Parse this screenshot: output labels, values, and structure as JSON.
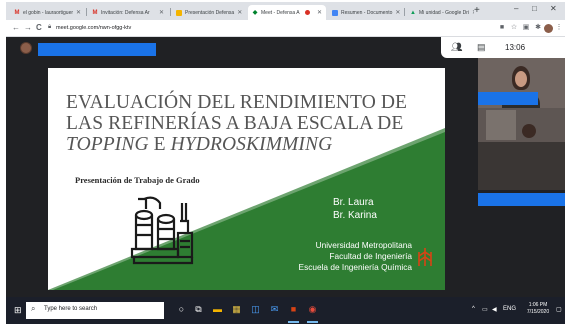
{
  "browser": {
    "tabs": [
      {
        "label": "el gobin - lauraortiguer",
        "icon": "gmail-icon",
        "icon_color": "#d93025",
        "active": false
      },
      {
        "label": "Invitación: Defensa Ar",
        "icon": "gmail-icon",
        "icon_color": "#d93025",
        "active": false
      },
      {
        "label": "Presentación Defensa",
        "icon": "slides-icon",
        "icon_color": "#f4b400",
        "active": false
      },
      {
        "label": "Meet - Defensa A",
        "icon": "meet-icon",
        "icon_color": "#00832d",
        "active": true,
        "recording": true
      },
      {
        "label": "Resumen - Documento",
        "icon": "docs-icon",
        "icon_color": "#4285f4",
        "active": false
      },
      {
        "label": "Mi unidad - Google Dri",
        "icon": "drive-icon",
        "icon_color": "#0f9d58",
        "active": false
      }
    ],
    "new_tab_label": "+",
    "window_controls": {
      "minimize": "–",
      "maximize": "□",
      "close": "✕"
    },
    "address": {
      "url": "meet.google.com/nwn-ofgg-ktv"
    },
    "nav": {
      "back": "←",
      "forward": "→",
      "reload": "C"
    }
  },
  "meet": {
    "time": "13:06",
    "icons": [
      "participants-icon",
      "chat-icon"
    ],
    "accent_color": "#1a73e8"
  },
  "slide": {
    "title_line1": "EVALUACIÓN DEL RENDIMIENTO DE",
    "title_line2": "LAS REFINERÍAS A BAJA ESCALA DE",
    "title_it1": "TOPPING",
    "title_conj": " E ",
    "title_it2": "HYDROSKIMMING",
    "subtitle": "Presentación de Trabajo de Grado",
    "authors": [
      "Br. Laura",
      "Br. Karina"
    ],
    "institution": [
      "Universidad Metropolitana",
      "Facultad de Ingeniería",
      "Escuela de Ingeniería Química"
    ],
    "green_color": "#2e7d32"
  },
  "taskbar": {
    "search_placeholder": "Type here to search",
    "apps": [
      "task-view-icon",
      "file-explorer-icon",
      "calculator-icon",
      "store-icon",
      "mail-icon",
      "edge-icon",
      "office-icon",
      "chrome-icon"
    ],
    "language": "ENG",
    "clock_time": "1:06 PM",
    "clock_date": "7/15/2020"
  }
}
